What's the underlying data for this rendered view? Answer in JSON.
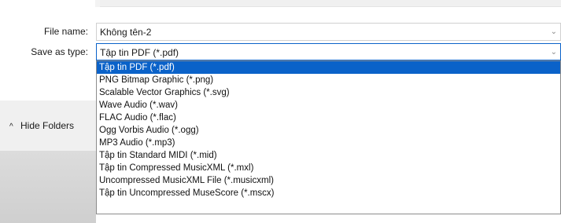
{
  "fields": {
    "file_name_label": "File name:",
    "file_name_value": "Không tên-2",
    "save_as_type_label": "Save as type:",
    "save_as_type_value": "Tập tin PDF (*.pdf)"
  },
  "dropdown": {
    "options": [
      "Tập tin PDF (*.pdf)",
      "PNG Bitmap Graphic (*.png)",
      "Scalable Vector Graphics (*.svg)",
      "Wave Audio (*.wav)",
      "FLAC Audio (*.flac)",
      "Ogg Vorbis Audio (*.ogg)",
      "MP3 Audio (*.mp3)",
      "Tập tin Standard MIDI (*.mid)",
      "Tập tin Compressed MusicXML (*.mxl)",
      "Uncompressed MusicXML File (*.musicxml)",
      "Tập tin Uncompressed MuseScore (*.mscx)"
    ],
    "selected_index": 0
  },
  "hide_folders": {
    "icon": "chevron-up-icon",
    "label": "Hide Folders"
  },
  "colors": {
    "selection": "#0a62c9"
  }
}
